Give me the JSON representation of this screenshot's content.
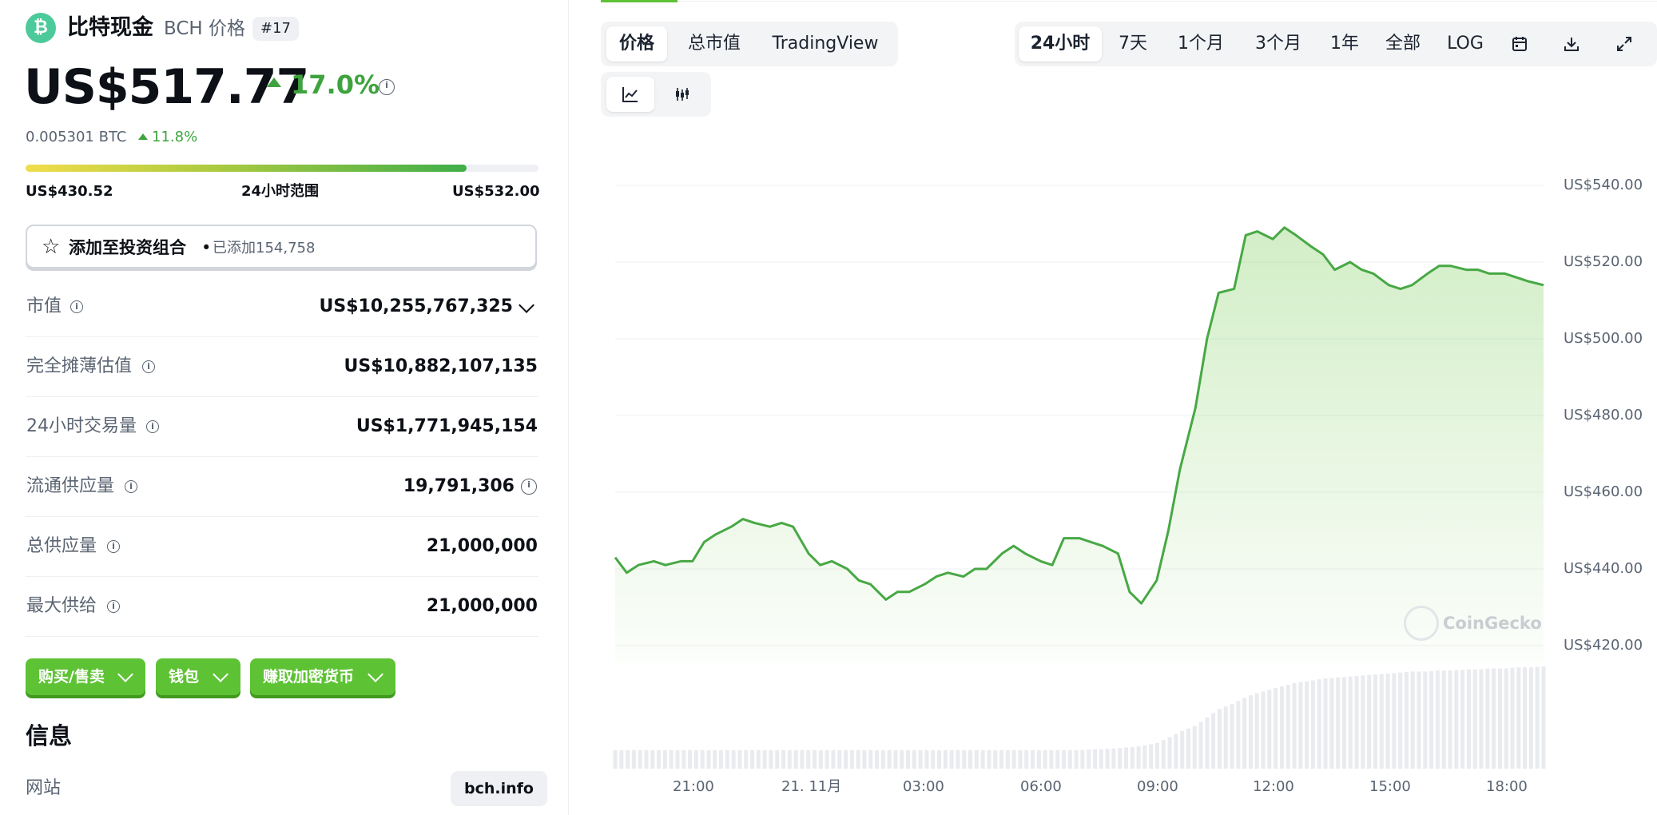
{
  "coin": {
    "logo_symbol": "₿",
    "name": "比特现金",
    "symbol_label": "BCH 价格",
    "rank": "#17",
    "price": "US$517.77",
    "change_24h": "17.0%",
    "btc_price": "0.005301 BTC",
    "btc_change": "11.8%"
  },
  "range": {
    "low": "US$430.52",
    "label": "24小时范围",
    "high": "US$532.00",
    "fill_fraction": 0.86
  },
  "portfolio": {
    "star_icon": "☆",
    "label": "添加至投资组合",
    "separator": "•",
    "added": "已添加154,758"
  },
  "stats": [
    {
      "label": "市值",
      "value": "US$10,255,767,325"
    },
    {
      "label": "完全摊薄估值",
      "value": "US$10,882,107,135"
    },
    {
      "label": "24小时交易量",
      "value": "US$1,771,945,154"
    },
    {
      "label": "流通供应量",
      "value": "19,791,306"
    },
    {
      "label": "总供应量",
      "value": "21,000,000"
    },
    {
      "label": "最大供给",
      "value": "21,000,000"
    }
  ],
  "actions": {
    "buy_sell": "购买/售卖",
    "wallet": "钱包",
    "earn": "赚取加密货币"
  },
  "info": {
    "heading": "信息",
    "website_label": "网站",
    "website_value": "bch.info"
  },
  "chart_tabs": [
    "价格",
    "总市值",
    "TradingView"
  ],
  "chart_tab_active": "价格",
  "time_ranges": [
    "24小时",
    "7天",
    "1个月",
    "3个月",
    "1年",
    "全部",
    "LOG"
  ],
  "time_range_active": "24小时",
  "chart_style_icons": [
    "line-chart-icon",
    "candlestick-chart-icon"
  ],
  "tool_icons": [
    "calendar-icon",
    "download-icon",
    "expand-icon"
  ],
  "watermark": "CoinGecko",
  "colors": {
    "accent_green": "#5ec235",
    "positive": "#3ea33e",
    "line": "#48a845"
  },
  "chart_data": {
    "type": "area",
    "title": "",
    "xlabel": "",
    "ylabel": "",
    "x_ticks": [
      "21:00",
      "21. 11月",
      "03:00",
      "06:00",
      "09:00",
      "12:00",
      "15:00",
      "18:00"
    ],
    "y_ticks": [
      "US$420.00",
      "US$440.00",
      "US$460.00",
      "US$480.00",
      "US$500.00",
      "US$520.00",
      "US$540.00"
    ],
    "ylim": [
      413,
      540
    ],
    "x_hours_from_start": [
      0,
      0.3,
      0.6,
      1,
      1.3,
      1.7,
      2,
      2.3,
      2.6,
      3,
      3.3,
      3.6,
      4,
      4.3,
      4.6,
      5,
      5.3,
      5.6,
      6,
      6.3,
      6.6,
      7,
      7.3,
      7.6,
      8,
      8.3,
      8.6,
      9,
      9.3,
      9.6,
      10,
      10.3,
      10.6,
      11,
      11.3,
      11.6,
      12,
      12.3,
      12.6,
      13,
      13.3,
      13.6,
      14,
      14.3,
      14.6,
      15,
      15.3,
      15.6,
      16,
      16.3,
      16.6,
      17,
      17.3,
      17.6,
      18,
      18.3,
      18.6,
      19,
      19.3,
      19.6,
      20,
      20.3,
      20.6,
      21,
      21.3,
      21.6,
      22,
      22.3,
      22.6,
      23,
      23.3,
      23.6,
      24
    ],
    "price": [
      443,
      439,
      441,
      442,
      441,
      442,
      442,
      447,
      449,
      451,
      453,
      452,
      451,
      452,
      451,
      444,
      441,
      442,
      440,
      437,
      436,
      432,
      434,
      434,
      436,
      438,
      439,
      438,
      440,
      440,
      444,
      446,
      444,
      442,
      441,
      448,
      448,
      447,
      446,
      444,
      434,
      431,
      437,
      450,
      466,
      482,
      500,
      512,
      513,
      527,
      528,
      526,
      529,
      527,
      524,
      522,
      518,
      520,
      518,
      517,
      514,
      513,
      514,
      517,
      519,
      519,
      518,
      518,
      517,
      517,
      516,
      515,
      514
    ],
    "volume_relative": [
      0.18,
      0.18,
      0.18,
      0.18,
      0.18,
      0.18,
      0.18,
      0.18,
      0.18,
      0.18,
      0.18,
      0.18,
      0.18,
      0.18,
      0.18,
      0.18,
      0.18,
      0.18,
      0.18,
      0.18,
      0.18,
      0.18,
      0.18,
      0.18,
      0.18,
      0.18,
      0.18,
      0.18,
      0.18,
      0.18,
      0.18,
      0.18,
      0.18,
      0.18,
      0.18,
      0.18,
      0.18,
      0.19,
      0.19,
      0.2,
      0.21,
      0.22,
      0.25,
      0.3,
      0.36,
      0.42,
      0.5,
      0.58,
      0.64,
      0.7,
      0.74,
      0.78,
      0.81,
      0.84,
      0.86,
      0.88,
      0.89,
      0.9,
      0.91,
      0.92,
      0.93,
      0.94,
      0.95,
      0.95,
      0.96,
      0.96,
      0.97,
      0.97,
      0.98,
      0.98,
      0.99,
      0.99,
      1.0
    ]
  }
}
